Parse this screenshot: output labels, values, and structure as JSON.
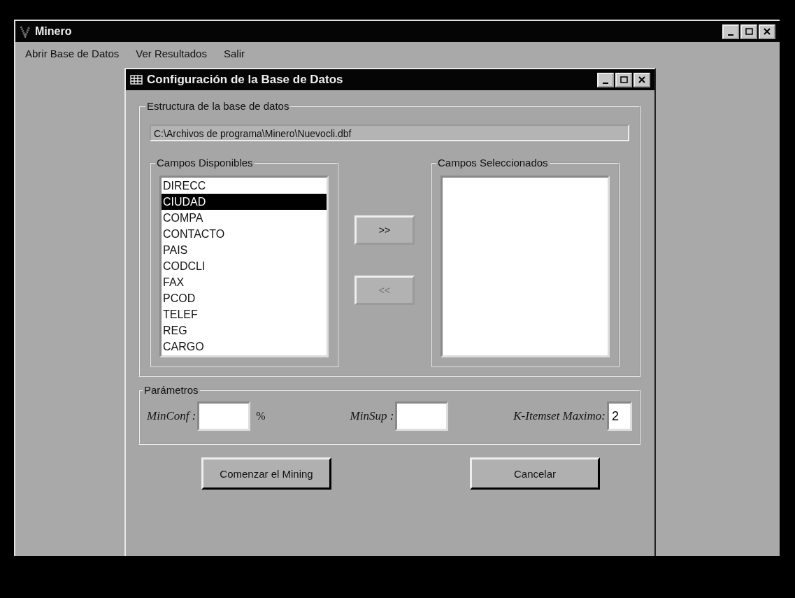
{
  "main_window": {
    "title": "Minero",
    "menu": [
      {
        "label": "Abrir Base de Datos"
      },
      {
        "label": "Ver Resultados"
      },
      {
        "label": "Salir"
      }
    ]
  },
  "dialog": {
    "title": "Configuración de la Base de Datos",
    "structure": {
      "label": "Estructura de la base de datos",
      "path": "C:\\Archivos de programa\\Minero\\Nuevocli.dbf",
      "available": {
        "label": "Campos Disponibles",
        "items": [
          {
            "label": "DIRECC",
            "selected": false
          },
          {
            "label": "CIUDAD",
            "selected": true
          },
          {
            "label": "COMPA",
            "selected": false
          },
          {
            "label": "CONTACTO",
            "selected": false
          },
          {
            "label": "PAIS",
            "selected": false
          },
          {
            "label": "CODCLI",
            "selected": false
          },
          {
            "label": "FAX",
            "selected": false
          },
          {
            "label": "PCOD",
            "selected": false
          },
          {
            "label": "TELEF",
            "selected": false
          },
          {
            "label": "REG",
            "selected": false
          },
          {
            "label": "CARGO",
            "selected": false
          }
        ]
      },
      "transfer_buttons": [
        {
          "label": ">>",
          "disabled": false
        },
        {
          "label": "<<",
          "disabled": true
        }
      ],
      "chosen": {
        "label": "Campos Seleccionados"
      }
    },
    "parameters": {
      "label": "Parámetros",
      "fields": [
        {
          "label": "MinConf :",
          "suffix": "%"
        },
        {
          "label": "MinSup :"
        },
        {
          "label": "K-Itemset Maximo:",
          "value": "2"
        }
      ]
    },
    "buttons": [
      {
        "label": "Comenzar el Mining"
      },
      {
        "label": "Cancelar"
      }
    ]
  }
}
